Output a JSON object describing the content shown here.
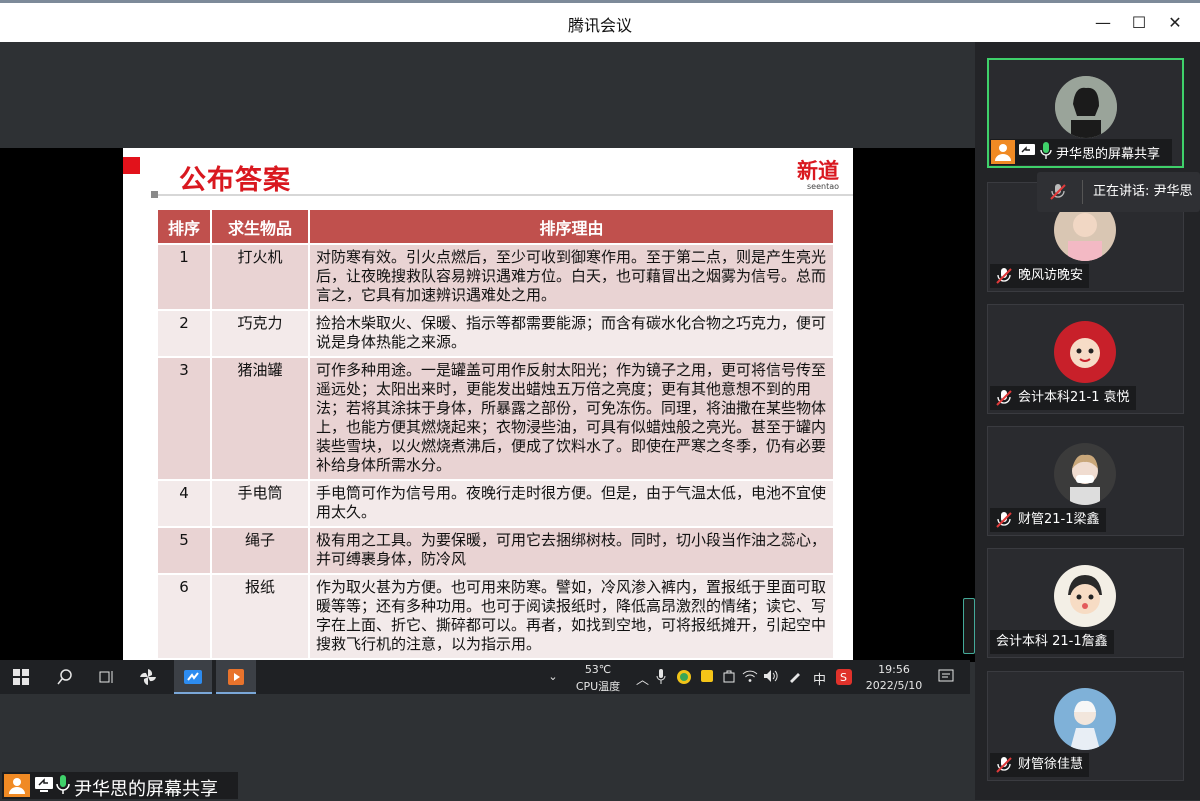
{
  "window": {
    "title": "腾讯会议",
    "minimize": "—",
    "maximize": "☐",
    "close": "✕"
  },
  "slide": {
    "title": "公布答案",
    "logo_big": "新道",
    "logo_small": "seentao",
    "headers": [
      "排序",
      "求生物品",
      "排序理由"
    ],
    "rows": [
      {
        "rank": "1",
        "item": "打火机",
        "reason": "对防寒有效。引火点燃后，至少可收到御寒作用。至于第二点，则是产生亮光后，让夜晚搜救队容易辨识遇难方位。白天，也可藉冒出之烟雾为信号。总而言之，它具有加速辨识遇难处之用。"
      },
      {
        "rank": "2",
        "item": "巧克力",
        "reason": "捡拾木柴取火、保暖、指示等都需要能源；而含有碳水化合物之巧克力，便可说是身体热能之来源。"
      },
      {
        "rank": "3",
        "item": "猪油罐",
        "reason": "可作多种用途。一是罐盖可用作反射太阳光；作为镜子之用，更可将信号传至遥远处；太阳出来时，更能发出蜡烛五万倍之亮度；更有其他意想不到的用法；若将其涂抹于身体，所暴露之部份，可免冻伤。同理，将油撒在某些物体上，也能方便其燃烧起来；衣物浸些油，可具有似蜡烛般之亮光。甚至于罐内装些雪块，以火燃烧煮沸后，便成了饮料水了。即使在严寒之冬季，仍有必要补给身体所需水分。"
      },
      {
        "rank": "4",
        "item": "手电筒",
        "reason": "手电筒可作为信号用。夜晚行走时很方便。但是，由于气温太低，电池不宜使用太久。"
      },
      {
        "rank": "5",
        "item": "绳子",
        "reason": "极有用之工具。为要保暖，可用它去捆绑树枝。同时，切小段当作油之蕊心，并可缚裹身体，防冷风"
      },
      {
        "rank": "6",
        "item": "报纸",
        "reason": "作为取火甚为方便。也可用来防寒。譬如，冷风渗入裤内，置报纸于里面可取暖等等；还有多种功用。也可于阅读报纸时，降低高昂激烈的情绪；读它、写字在上面、折它、撕碎都可以。再者，如找到空地，可将报纸摊开，引起空中搜救飞行机的注意，以为指示用。"
      }
    ]
  },
  "taskbar": {
    "cpu_temp": "53℃",
    "cpu_label": "CPU温度",
    "ime": "中",
    "time": "19:56",
    "date": "2022/5/10"
  },
  "share_label": "尹华思的屏幕共享",
  "speaking": "正在讲话: 尹华思",
  "participants": [
    {
      "name": "尹华思的屏幕共享"
    },
    {
      "name": "晚风访晚安"
    },
    {
      "name": "会计本科21-1 袁悦"
    },
    {
      "name": "财管21-1梁鑫"
    },
    {
      "name": "会计本科 21-1詹鑫"
    },
    {
      "name": "财管徐佳慧"
    }
  ],
  "colors": {
    "accent_red": "#d9181f",
    "table_header": "#c0504d",
    "row_dark": "#e9d3d3",
    "row_light": "#f3eaea",
    "active_border": "#3fd16a"
  }
}
